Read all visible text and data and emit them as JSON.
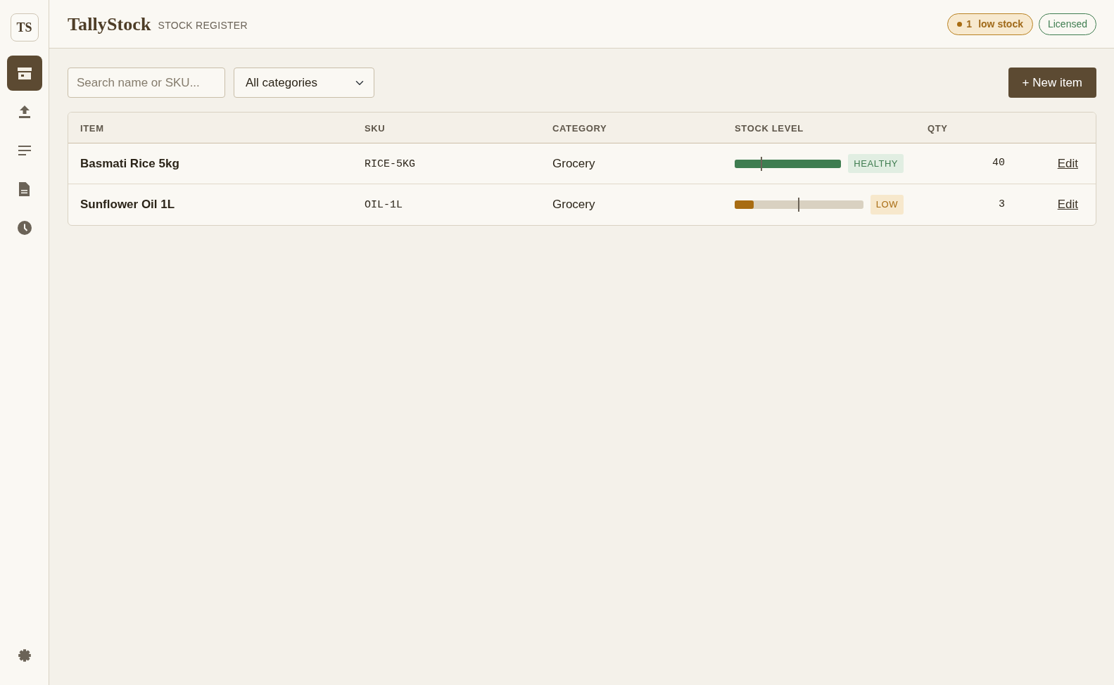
{
  "sidebar": {
    "logo": "TS",
    "items": [
      {
        "selected": true
      },
      {
        "selected": false
      },
      {
        "selected": false
      },
      {
        "selected": false
      },
      {
        "selected": false
      }
    ]
  },
  "header": {
    "brand": "TallyStock",
    "subtitle": "STOCK REGISTER",
    "alert": {
      "count": "1",
      "label": "low stock"
    },
    "license": "Licensed"
  },
  "toolbar": {
    "search": {
      "placeholder": "Search name or SKU..."
    },
    "category_filter": {
      "value": "All categories"
    },
    "new_button": "+ New item"
  },
  "table": {
    "columns": [
      "ITEM",
      "SKU",
      "CATEGORY",
      "STOCK LEVEL",
      "QTY"
    ],
    "rows": [
      {
        "item": "Basmati Rice 5kg",
        "sku": "RICE-5KG",
        "category": "Grocery",
        "stock": {
          "level": 1.0,
          "reorder_mark": {
            "level": 0.25
          },
          "status": {
            "label": "HEALTHY",
            "kind": "healthy"
          }
        },
        "qty": "40",
        "action": "Edit"
      },
      {
        "item": "Sunflower Oil 1L",
        "sku": "OIL-1L",
        "category": "Grocery",
        "stock": {
          "level": 0.15,
          "reorder_mark": {
            "level": 0.5
          },
          "status": {
            "label": "LOW",
            "kind": "low"
          }
        },
        "qty": "3",
        "action": "Edit"
      }
    ]
  }
}
